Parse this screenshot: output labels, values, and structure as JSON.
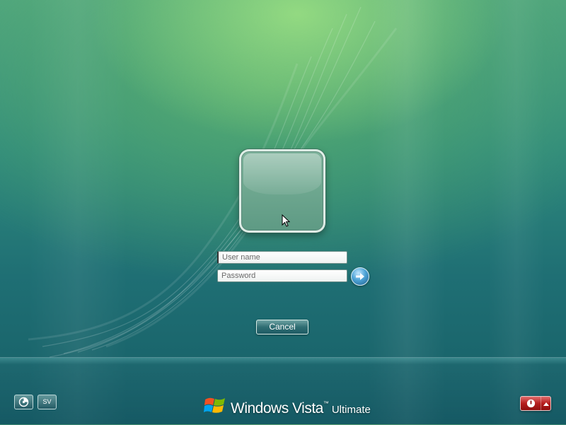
{
  "screen": "Windows Vista logon",
  "login": {
    "username_placeholder": "User name",
    "username_value": "",
    "password_placeholder": "Password",
    "password_value": "",
    "submit_icon": "arrow-right-icon"
  },
  "buttons": {
    "cancel_label": "Cancel"
  },
  "bottom_left": {
    "ease_of_access_icon": "ease-of-access-icon",
    "language_label": "SV"
  },
  "branding": {
    "product": "Windows Vista",
    "trademark": "™",
    "edition": "Ultimate"
  },
  "bottom_right": {
    "power_icon": "power-icon",
    "menu_icon": "triangle-up-icon"
  },
  "colors": {
    "power_button": "#b51d1d",
    "go_button": "#4da3d6"
  }
}
